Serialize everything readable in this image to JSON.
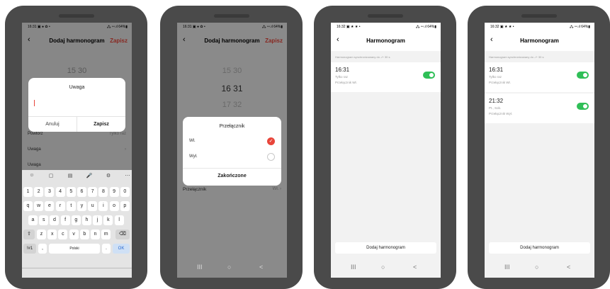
{
  "phone1": {
    "status_left": "16:31 ▣ ● ✿ •",
    "status_right": "⁂ ꟷ.ıl 64%▮",
    "title": "Dodaj harmonogram",
    "save": "Zapisz",
    "time": "15 30",
    "dialog_title": "Uwaga",
    "cancel": "Anuluj",
    "confirm": "Zapisz",
    "rows": [
      "Powtórz",
      "Uwaga",
      "Uwaga"
    ],
    "row1_value": "Tylko raz",
    "keyboard": {
      "toolbar": [
        "☺",
        "▢",
        "▤",
        "🎤",
        "⚙",
        "⋯"
      ],
      "row1": [
        "1",
        "2",
        "3",
        "4",
        "5",
        "6",
        "7",
        "8",
        "9",
        "0"
      ],
      "row2": [
        "q",
        "w",
        "e",
        "r",
        "t",
        "y",
        "u",
        "i",
        "o",
        "p"
      ],
      "row3": [
        "a",
        "s",
        "d",
        "f",
        "g",
        "h",
        "j",
        "k",
        "l"
      ],
      "row4": [
        "z",
        "x",
        "c",
        "v",
        "b",
        "n",
        "m"
      ],
      "shift": "⇧",
      "backspace": "⌫",
      "symbols": "!#1",
      "comma": ",",
      "space": "Polski",
      "period": ".",
      "ok": "OK"
    }
  },
  "phone2": {
    "status_left": "16:31 ▣ ● ✿ •",
    "status_right": "⁂ ꟷ.ıl 64%▮",
    "title": "Dodaj harmonogram",
    "save": "Zapisz",
    "picker": [
      "15  30",
      "16  31",
      "17  32"
    ],
    "dialog_title": "Przełącznik",
    "options": [
      "Wł.",
      "Wył."
    ],
    "done": "Zakończone",
    "bottom_row_label": "Przełącznik",
    "bottom_row_value": "Wł. ›",
    "nav": [
      "III",
      "○",
      "<"
    ]
  },
  "phone3": {
    "status_left": "16:32 ▣ ★ ★ •",
    "status_right": "⁂ ꟷ.ıl 64%▮",
    "title": "Harmonogram",
    "subtitle": "Harmonogram synchronizowany do -/+ 30 s",
    "items": [
      {
        "time": "16:31",
        "repeat": "Tylko raz",
        "action": "Przełącznik Wł.",
        "enabled": true
      }
    ],
    "add_button": "Dodaj harmonogram",
    "nav": [
      "III",
      "○",
      "<"
    ]
  },
  "phone4": {
    "status_left": "16:32 ▣ ★ ★ •",
    "status_right": "⁂ ꟷ.ıl 64%▮",
    "title": "Harmonogram",
    "subtitle": "Harmonogram synchronizowany do -/+ 30 s",
    "items": [
      {
        "time": "16:31",
        "repeat": "Tylko raz",
        "action": "Przełącznik Wł.",
        "enabled": true
      },
      {
        "time": "21:32",
        "repeat": "Pt., Sob.",
        "action": "Przełącznik Wył.",
        "enabled": true
      }
    ],
    "add_button": "Dodaj harmonogram",
    "nav": [
      "III",
      "○",
      "<"
    ]
  },
  "colors": {
    "accent": "#e8453a",
    "toggle_on": "#2fbf57",
    "phone_body": "#4a4a4a",
    "done_blue": "#1a1a1a"
  }
}
